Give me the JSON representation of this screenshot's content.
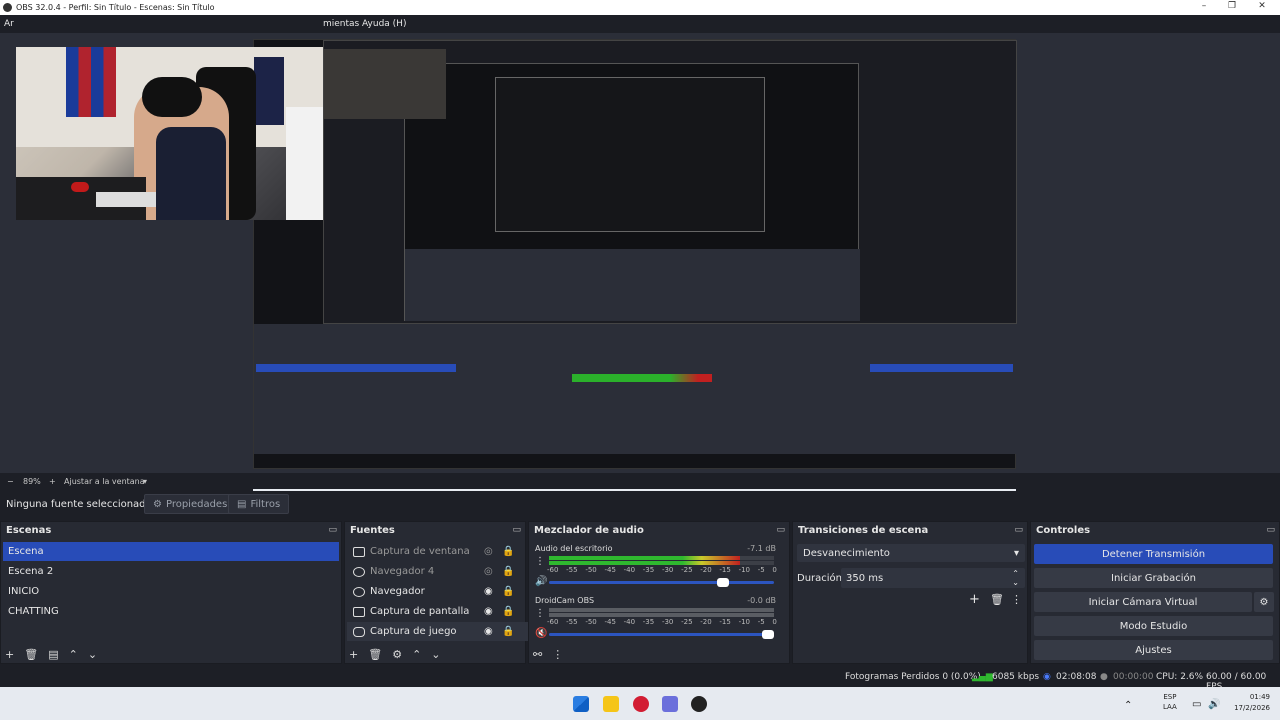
{
  "window": {
    "title": "OBS 32.0.4 - Perfil: Sin Título - Escenas: Sin Título"
  },
  "menu": {
    "first": "Ar",
    "tools": "mientas",
    "help": "Ayuda (H)"
  },
  "preview": {
    "zoom": "89%",
    "zoom_minus": "−",
    "zoom_plus": "+",
    "fit": "Ajustar a la ventana"
  },
  "sources_toolbar": {
    "selected": "Ninguna fuente seleccionad",
    "properties": "Propiedades",
    "filters": "Filtros"
  },
  "scenes": {
    "title": "Escenas",
    "items": [
      "Escena",
      "Escena 2",
      "INICIO",
      "CHATTING"
    ],
    "selected_index": 0
  },
  "sources": {
    "title": "Fuentes",
    "items": [
      {
        "label": "Captura de ventana",
        "icon": "window-icon",
        "visible": false
      },
      {
        "label": "Navegador 4",
        "icon": "globe-icon",
        "visible": false
      },
      {
        "label": "Navegador",
        "icon": "globe-icon",
        "visible": true
      },
      {
        "label": "Captura de pantalla",
        "icon": "monitor-icon",
        "visible": true
      },
      {
        "label": "Captura de juego",
        "icon": "gamepad-icon",
        "visible": true
      }
    ]
  },
  "mixer": {
    "title": "Mezclador de audio",
    "channels": [
      {
        "name": "Audio del escritorio",
        "db": "-7.1 dB",
        "level": 0.85,
        "volume": 0.8,
        "muted": false
      },
      {
        "name": "DroidCam OBS",
        "db": "-0.0 dB",
        "level": 0.0,
        "volume": 1.0,
        "muted": true
      }
    ],
    "ticks": [
      "-60",
      "-55",
      "-50",
      "-45",
      "-40",
      "-35",
      "-30",
      "-25",
      "-20",
      "-15",
      "-10",
      "-5",
      "0"
    ]
  },
  "transitions": {
    "title": "Transiciones de escena",
    "selected": "Desvanecimiento",
    "duration_label": "Duración",
    "duration_value": "350 ms"
  },
  "controls": {
    "title": "Controles",
    "stop_stream": "Detener Transmisión",
    "start_record": "Iniciar Grabación",
    "start_vcam": "Iniciar Cámara Virtual",
    "studio_mode": "Modo Estudio",
    "settings": "Ajustes"
  },
  "status": {
    "dropped": "Fotogramas Perdidos 0 (0.0%)",
    "bitrate": "6085 kbps",
    "live_time": "02:08:08",
    "rec_time": "00:00:00",
    "cpu": "CPU: 2.6%",
    "fps": "60.00 / 60.00 FPS"
  },
  "taskbar": {
    "lang1": "ESP",
    "lang2": "LAA",
    "time": "01:49",
    "date": "17/2/2026"
  },
  "colors": {
    "accent": "#284cb8",
    "bg": "#1d1f26",
    "panel": "#272a33"
  }
}
